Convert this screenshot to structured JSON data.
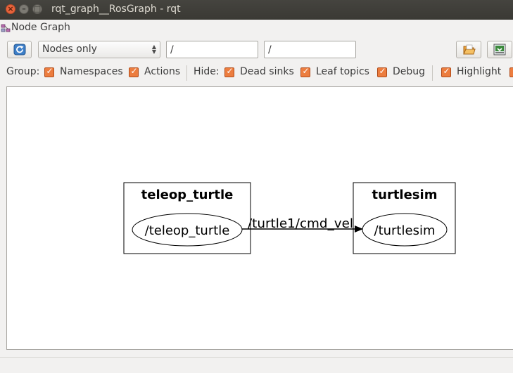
{
  "window": {
    "title": "rqt_graph__RosGraph - rqt"
  },
  "menu": {
    "plugin_title": "Node Graph"
  },
  "toolbar": {
    "graph_type": "Nodes only",
    "node_filter": "/",
    "topic_filter": "/"
  },
  "options": {
    "group_label": "Group:",
    "namespaces": "Namespaces",
    "actions": "Actions",
    "hide_label": "Hide:",
    "dead_sinks": "Dead sinks",
    "leaf_topics": "Leaf topics",
    "debug": "Debug",
    "highlight": "Highlight"
  },
  "graph": {
    "nodes": [
      {
        "cluster": "teleop_turtle",
        "name": "/teleop_turtle"
      },
      {
        "cluster": "turtlesim",
        "name": "/turtlesim"
      }
    ],
    "edges": [
      {
        "label": "/turtle1/cmd_vel",
        "from": "/teleop_turtle",
        "to": "/turtlesim"
      }
    ]
  },
  "colors": {
    "checkbox": "#ec7d3f",
    "close_button": "#e8643c",
    "titlebar": "#3c3b37"
  }
}
